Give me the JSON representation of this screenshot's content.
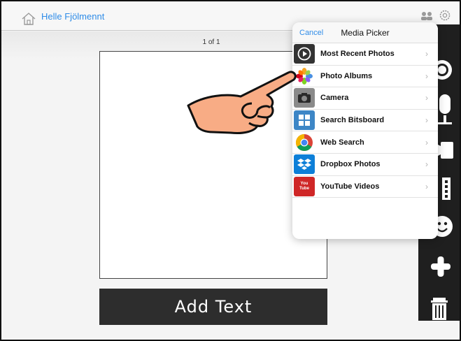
{
  "topbar": {
    "owner": "Helle Fjölmennt"
  },
  "workspace": {
    "page_counter": "1 of 1",
    "add_text_label": "Add Text"
  },
  "media_picker": {
    "cancel_label": "Cancel",
    "title": "Media Picker",
    "items": [
      {
        "label": "Most Recent Photos",
        "icon": "recent-photos-icon"
      },
      {
        "label": "Photo Albums",
        "icon": "photos-flower-icon"
      },
      {
        "label": "Camera",
        "icon": "camera-icon"
      },
      {
        "label": "Search Bitsboard",
        "icon": "bitsboard-icon"
      },
      {
        "label": "Web Search",
        "icon": "chrome-icon"
      },
      {
        "label": "Dropbox Photos",
        "icon": "dropbox-icon"
      },
      {
        "label": "YouTube Videos",
        "icon": "youtube-icon"
      }
    ],
    "youtube_badge": "You Tube"
  },
  "colors": {
    "accent": "#2f8ce8",
    "toolbar": "#1f1f1f",
    "hand_skin": "#f8ac85"
  }
}
